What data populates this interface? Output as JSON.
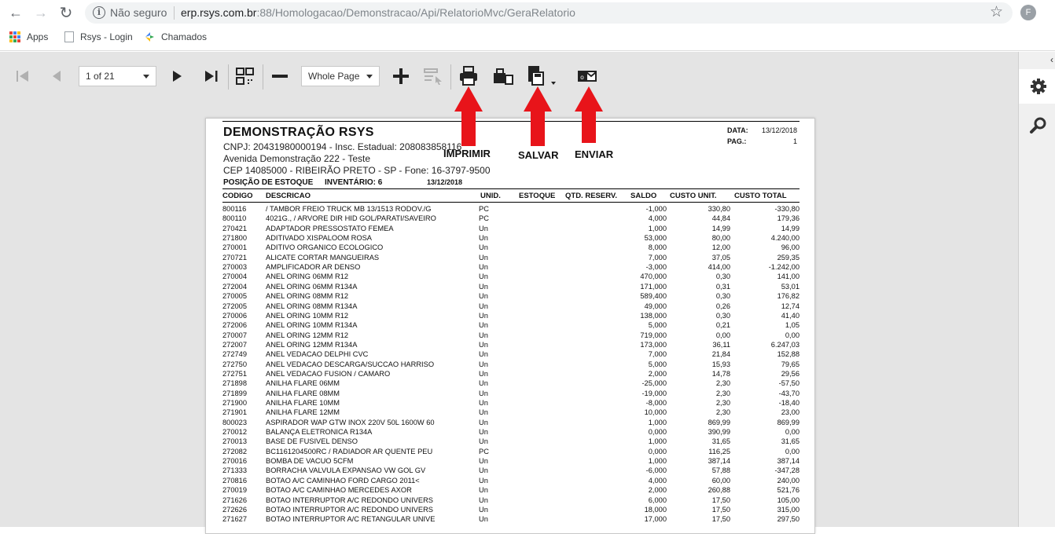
{
  "browser": {
    "back": "←",
    "forward": "→",
    "reload": "↻",
    "security_label": "Não seguro",
    "url_host": "erp.rsys.com.br",
    "url_path": ":88/Homologacao/Demonstracao/Api/RelatorioMvc/GeraRelatorio",
    "star": "☆",
    "profile_initial": "F",
    "bookmarks": [
      {
        "label": "Apps"
      },
      {
        "label": "Rsys - Login"
      },
      {
        "label": "Chamados"
      }
    ]
  },
  "viewer": {
    "page_select": "1 of 21",
    "zoom_select": "Whole Page",
    "collapse": "‹"
  },
  "annotations": {
    "print": "IMPRIMIR",
    "save": "SALVAR",
    "send": "ENVIAR",
    "arrow_color": "#e8141a"
  },
  "report": {
    "title": "DEMONSTRAÇÃO RSYS",
    "cnpj": "CNPJ: 20431980000194 - Insc. Estadual: 208083858116",
    "address": "Avenida Demonstração 222 - Teste",
    "cep": "CEP 14085000 - RIBEIRÃO PRETO - SP - Fone: 16-3797-9500",
    "subtitle": "POSIÇÃO DE ESTOQUE",
    "inventory": "INVENTÁRIO: 6",
    "subtitle_date": "13/12/2018",
    "date_label": "DATA:",
    "date_value": "13/12/2018",
    "page_label": "PAG.:",
    "page_value": "1",
    "columns": {
      "codigo": "CODIGO",
      "descricao": "DESCRICAO",
      "unid": "UNID.",
      "estoque": "ESTOQUE",
      "reserva": "QTD. RESERV.",
      "saldo": "SALDO",
      "custo": "CUSTO UNIT.",
      "total": "CUSTO TOTAL"
    },
    "rows": [
      {
        "codigo": "800116",
        "descricao": "/ TAMBOR FREIO TRUCK MB 13/1513 RODOV./G",
        "unid": "PC",
        "saldo": "-1,000",
        "custo": "330,80",
        "total": "-330,80"
      },
      {
        "codigo": "800110",
        "descricao": "4021G., / ARVORE DIR HID GOL/PARATI/SAVEIRO",
        "unid": "PC",
        "saldo": "4,000",
        "custo": "44,84",
        "total": "179,36"
      },
      {
        "codigo": "270421",
        "descricao": "ADAPTADOR PRESSOSTATO FEMEA",
        "unid": "Un",
        "saldo": "1,000",
        "custo": "14,99",
        "total": "14,99"
      },
      {
        "codigo": "271800",
        "descricao": "ADITIVADO XISPALOOM ROSA",
        "unid": "Un",
        "saldo": "53,000",
        "custo": "80,00",
        "total": "4.240,00"
      },
      {
        "codigo": "270001",
        "descricao": "ADITIVO ORGANICO ECOLOGICO",
        "unid": "Un",
        "saldo": "8,000",
        "custo": "12,00",
        "total": "96,00"
      },
      {
        "codigo": "270721",
        "descricao": "ALICATE CORTAR MANGUEIRAS",
        "unid": "Un",
        "saldo": "7,000",
        "custo": "37,05",
        "total": "259,35"
      },
      {
        "codigo": "270003",
        "descricao": "AMPLIFICADOR AR DENSO",
        "unid": "Un",
        "saldo": "-3,000",
        "custo": "414,00",
        "total": "-1.242,00"
      },
      {
        "codigo": "270004",
        "descricao": "ANEL ORING 06MM R12",
        "unid": "Un",
        "saldo": "470,000",
        "custo": "0,30",
        "total": "141,00"
      },
      {
        "codigo": "272004",
        "descricao": "ANEL ORING 06MM R134A",
        "unid": "Un",
        "saldo": "171,000",
        "custo": "0,31",
        "total": "53,01"
      },
      {
        "codigo": "270005",
        "descricao": "ANEL ORING 08MM R12",
        "unid": "Un",
        "saldo": "589,400",
        "custo": "0,30",
        "total": "176,82"
      },
      {
        "codigo": "272005",
        "descricao": "ANEL ORING 08MM R134A",
        "unid": "Un",
        "saldo": "49,000",
        "custo": "0,26",
        "total": "12,74"
      },
      {
        "codigo": "270006",
        "descricao": "ANEL ORING 10MM R12",
        "unid": "Un",
        "saldo": "138,000",
        "custo": "0,30",
        "total": "41,40"
      },
      {
        "codigo": "272006",
        "descricao": "ANEL ORING 10MM R134A",
        "unid": "Un",
        "saldo": "5,000",
        "custo": "0,21",
        "total": "1,05"
      },
      {
        "codigo": "270007",
        "descricao": "ANEL ORING 12MM R12",
        "unid": "Un",
        "saldo": "719,000",
        "custo": "0,00",
        "total": "0,00"
      },
      {
        "codigo": "272007",
        "descricao": "ANEL ORING 12MM R134A",
        "unid": "Un",
        "saldo": "173,000",
        "custo": "36,11",
        "total": "6.247,03"
      },
      {
        "codigo": "272749",
        "descricao": "ANEL VEDACAO DELPHI CVC",
        "unid": "Un",
        "saldo": "7,000",
        "custo": "21,84",
        "total": "152,88"
      },
      {
        "codigo": "272750",
        "descricao": "ANEL VEDACAO DESCARGA/SUCCAO HARRISO",
        "unid": "Un",
        "saldo": "5,000",
        "custo": "15,93",
        "total": "79,65"
      },
      {
        "codigo": "272751",
        "descricao": "ANEL VEDACAO FUSION / CAMARO",
        "unid": "Un",
        "saldo": "2,000",
        "custo": "14,78",
        "total": "29,56"
      },
      {
        "codigo": "271898",
        "descricao": "ANILHA FLARE 06MM",
        "unid": "Un",
        "saldo": "-25,000",
        "custo": "2,30",
        "total": "-57,50"
      },
      {
        "codigo": "271899",
        "descricao": "ANILHA FLARE 08MM",
        "unid": "Un",
        "saldo": "-19,000",
        "custo": "2,30",
        "total": "-43,70"
      },
      {
        "codigo": "271900",
        "descricao": "ANILHA FLARE 10MM",
        "unid": "Un",
        "saldo": "-8,000",
        "custo": "2,30",
        "total": "-18,40"
      },
      {
        "codigo": "271901",
        "descricao": "ANILHA FLARE 12MM",
        "unid": "Un",
        "saldo": "10,000",
        "custo": "2,30",
        "total": "23,00"
      },
      {
        "codigo": "800023",
        "descricao": "ASPIRADOR WAP GTW INOX 220V 50L 1600W 60",
        "unid": "Un",
        "saldo": "1,000",
        "custo": "869,99",
        "total": "869,99"
      },
      {
        "codigo": "270012",
        "descricao": "BALANÇA ELETRONICA R134A",
        "unid": "Un",
        "saldo": "0,000",
        "custo": "390,99",
        "total": "0,00"
      },
      {
        "codigo": "270013",
        "descricao": "BASE DE FUSIVEL DENSO",
        "unid": "Un",
        "saldo": "1,000",
        "custo": "31,65",
        "total": "31,65"
      },
      {
        "codigo": "272082",
        "descricao": "BC1161204500RC / RADIADOR AR QUENTE PEU",
        "unid": "PC",
        "saldo": "0,000",
        "custo": "116,25",
        "total": "0,00"
      },
      {
        "codigo": "270016",
        "descricao": "BOMBA DE VACUO 5CFM",
        "unid": "Un",
        "saldo": "1,000",
        "custo": "387,14",
        "total": "387,14"
      },
      {
        "codigo": "271333",
        "descricao": "BORRACHA VALVULA EXPANSAO VW GOL GV",
        "unid": "Un",
        "saldo": "-6,000",
        "custo": "57,88",
        "total": "-347,28"
      },
      {
        "codigo": "270816",
        "descricao": "BOTAO A/C CAMINHAO FORD CARGO 2011<",
        "unid": "Un",
        "saldo": "4,000",
        "custo": "60,00",
        "total": "240,00"
      },
      {
        "codigo": "270019",
        "descricao": "BOTAO A/C CAMINHAO MERCEDES AXOR",
        "unid": "Un",
        "saldo": "2,000",
        "custo": "260,88",
        "total": "521,76"
      },
      {
        "codigo": "271626",
        "descricao": "BOTAO INTERRUPTOR A/C REDONDO UNIVERS",
        "unid": "Un",
        "saldo": "6,000",
        "custo": "17,50",
        "total": "105,00"
      },
      {
        "codigo": "272626",
        "descricao": "BOTAO INTERRUPTOR A/C REDONDO UNIVERS",
        "unid": "Un",
        "saldo": "18,000",
        "custo": "17,50",
        "total": "315,00"
      },
      {
        "codigo": "271627",
        "descricao": "BOTAO INTERRUPTOR A/C RETANGULAR UNIVE",
        "unid": "Un",
        "saldo": "17,000",
        "custo": "17,50",
        "total": "297,50"
      }
    ]
  }
}
